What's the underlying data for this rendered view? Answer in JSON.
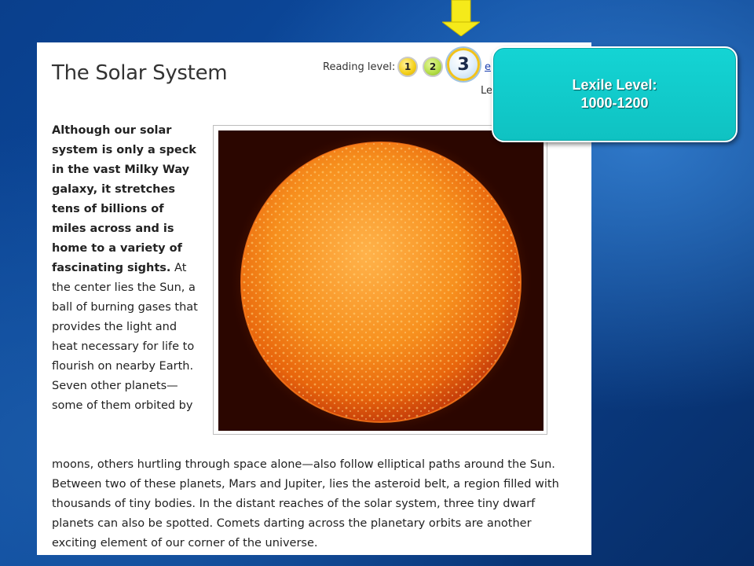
{
  "accent_colors": {
    "arrow": "#f5ea1a",
    "callout": "#14cccc",
    "background": "#0c4a9e"
  },
  "page": {
    "title": "The Solar System",
    "reading_level_label": "Reading level:",
    "levels": [
      "1",
      "2",
      "3"
    ],
    "selected_level": "3",
    "link_fragment": "e",
    "hidden_fragment": "Le"
  },
  "article": {
    "intro_bold": "Although our solar system is only a speck in the vast Milky Way galaxy, it stretches tens of billions of miles across and is home to a variety of fascinating sights.",
    "intro_rest": " At the center lies the Sun, a ball of burning gases that provides the light and heat necessary for life to flourish on nearby Earth. Seven other planets—some of them orbited by",
    "continuation": "moons, others hurtling through space alone—also follow elliptical paths around the Sun. Between two of these planets, Mars and Jupiter, lies the asteroid belt, a region filled with thousands of tiny bodies. In the distant reaches of the solar system, three tiny dwarf planets can also be spotted. Comets darting across the planetary orbits are another exciting element of our corner of the universe."
  },
  "callout": {
    "line1": "Lexile Level:",
    "line2": "1000-1200"
  }
}
